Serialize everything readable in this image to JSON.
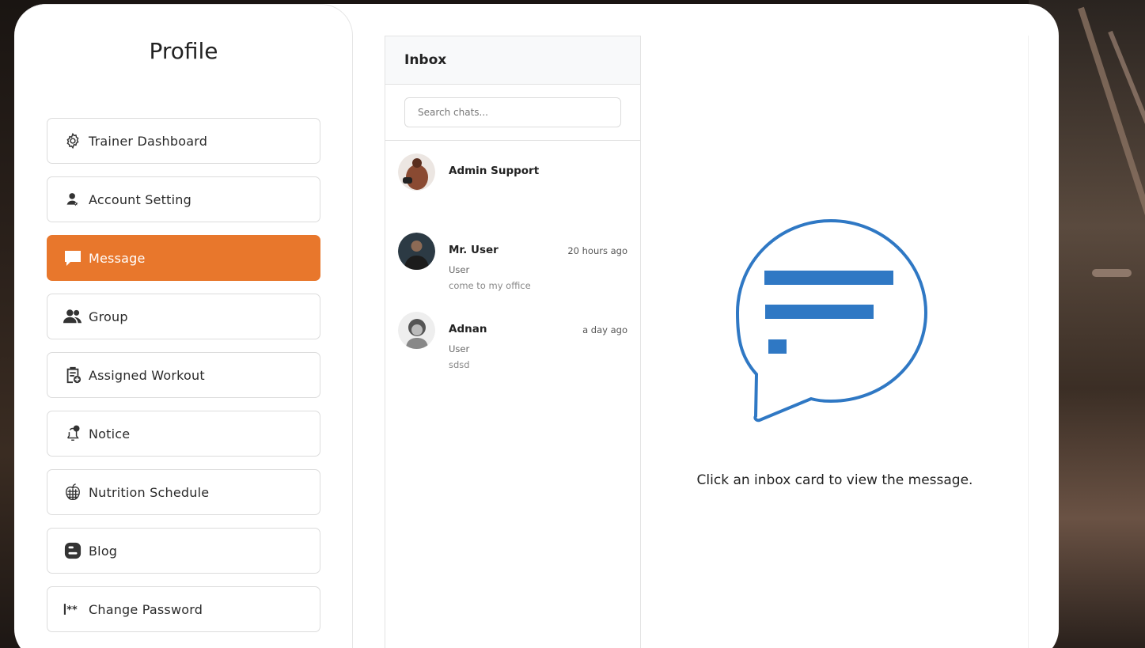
{
  "profile": {
    "title": "Profile"
  },
  "menu": [
    {
      "label": "Trainer Dashboard",
      "icon": "gear-icon",
      "active": false
    },
    {
      "label": "Account Setting",
      "icon": "user-icon",
      "active": false
    },
    {
      "label": "Message",
      "icon": "chat-icon",
      "active": true
    },
    {
      "label": "Group",
      "icon": "users-icon",
      "active": false
    },
    {
      "label": "Assigned Workout",
      "icon": "clipboard-icon",
      "active": false
    },
    {
      "label": "Notice",
      "icon": "bell-icon",
      "active": false
    },
    {
      "label": "Nutrition Schedule",
      "icon": "apple-icon",
      "active": false
    },
    {
      "label": "Blog",
      "icon": "blog-icon",
      "active": false
    },
    {
      "label": "Change Password",
      "icon": "password-icon",
      "active": false
    }
  ],
  "inbox": {
    "title": "Inbox",
    "search_placeholder": "Search chats...",
    "chats": [
      {
        "name": "Admin Support",
        "time": "",
        "role": "",
        "preview": ""
      },
      {
        "name": "Mr. User",
        "time": "20 hours ago",
        "role": "User",
        "preview": "come to my office"
      },
      {
        "name": "Adnan",
        "time": "a day ago",
        "role": "User",
        "preview": "sdsd"
      }
    ]
  },
  "viewer": {
    "empty_message": "Click an inbox card to view the message."
  },
  "colors": {
    "accent": "#e8772c",
    "bubble": "#2f78c4"
  }
}
